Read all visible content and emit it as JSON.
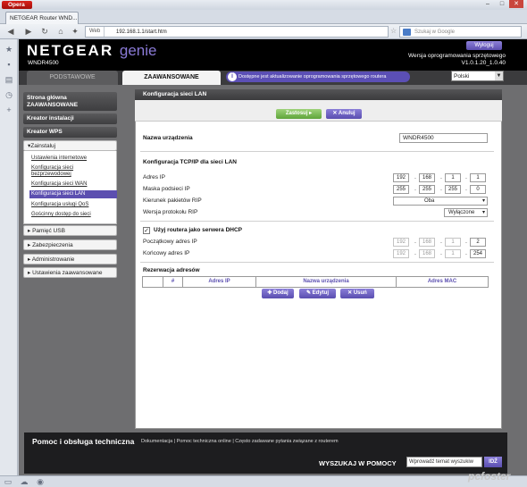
{
  "browser": {
    "menu_label": "Opera",
    "tab_title": "NETGEAR Router WND...",
    "web_badge": "Web",
    "url": "192.168.1.1/start.htm",
    "search_placeholder": "Szukaj w Google",
    "win_min": "–",
    "win_max": "□",
    "win_close": "✕"
  },
  "header": {
    "logo_brand": "NETGEAR",
    "logo_product": "genie",
    "model": "WNDR4500",
    "logout_label": "Wyloguj",
    "firmware_label": "Wersja oprogramowania sprzętowego",
    "firmware_version": "V1.0.1.20_1.0.40"
  },
  "tabs": {
    "basic": "PODSTAWOWE",
    "advanced": "ZAAWANSOWANE",
    "update_notice": "Dostępne jest aktualizowanie oprogramowania sprzętowego routera",
    "update_icon": "i",
    "language": "Polski"
  },
  "nav": {
    "home": "Strona główna ZAAWANSOWANE",
    "wizard": "Kreator instalacji",
    "wps": "Kreator WPS",
    "setup": "▾Zainstaluj",
    "setup_items": [
      "Ustawienia internetowe",
      "Konfiguracja sieci bezprzewodowej",
      "Konfiguracja sieci WAN",
      "Konfiguracja sieci LAN",
      "Konfiguracja usługi QoS",
      "Gościnny dostęp do sieci"
    ],
    "usb": "▸ Pamięć USB",
    "security": "▸ Zabezpieczenia",
    "admin": "▸ Administrowanie",
    "advanced_settings": "▸ Ustawienia zaawansowane"
  },
  "content": {
    "title": "Konfiguracja sieci LAN",
    "apply_label": "Zastosuj ▸",
    "cancel_label": "✕ Anuluj",
    "device_name_label": "Nazwa urządzenia",
    "device_name_value": "WNDR4500",
    "tcpip_heading": "Konfiguracja TCP/IP dla sieci LAN",
    "ip_label": "Adres IP",
    "ip": [
      "192",
      "168",
      "1",
      "1"
    ],
    "mask_label": "Maska podsieci IP",
    "mask": [
      "255",
      "255",
      "255",
      "0"
    ],
    "rip_dir_label": "Kierunek pakietów RIP",
    "rip_dir_value": "Oba",
    "rip_ver_label": "Wersja protokołu RIP",
    "rip_ver_value": "Wyłączone",
    "dhcp_check": "✓",
    "dhcp_label": "Użyj routera jako serwera DHCP",
    "start_label": "Początkowy adres IP",
    "start_ip": [
      "192",
      "168",
      "1",
      "2"
    ],
    "end_label": "Końcowy adres IP",
    "end_ip": [
      "192",
      "168",
      "1",
      "254"
    ],
    "reservation_heading": "Rezerwacja adresów",
    "table_headers": [
      "",
      "#",
      "Adres IP",
      "Nazwa urządzenia",
      "Adres MAC"
    ],
    "add_label": "✚ Dodaj",
    "edit_label": "✎ Edytuj",
    "delete_label": "✕ Usuń"
  },
  "footer": {
    "title": "Pomoc i obsługa techniczna",
    "links": "Dokumentacja | Pomoc techniczna online | Często zadawane pytania związane z routerem",
    "search_label": "WYSZUKAJ W POMOCY",
    "search_placeholder": "Wprowadź temat wyszukiw",
    "go_label": "IDŹ"
  },
  "watermark": "pcfoster",
  "colors": {
    "accent": "#5b4fb0",
    "apply_green": "#6fb04a",
    "header_bg": "#000000"
  }
}
